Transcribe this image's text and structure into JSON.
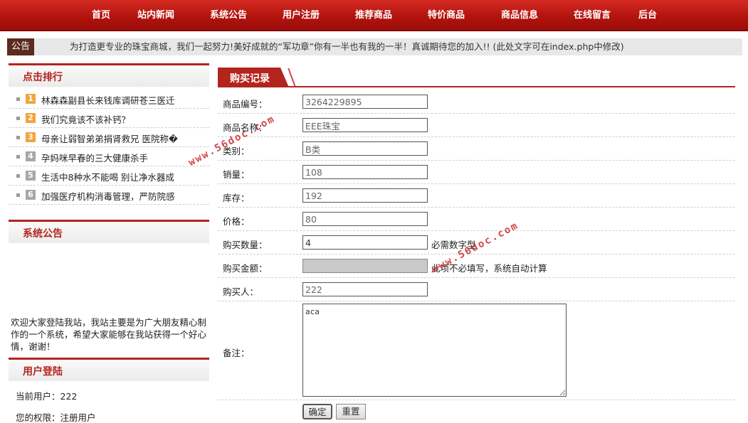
{
  "nav": {
    "items": [
      "首页",
      "站内新闻",
      "系统公告",
      "用户注册",
      "推荐商品",
      "特价商品",
      "商品信息",
      "在线留言",
      "后台"
    ]
  },
  "notice": {
    "tag": "公告",
    "text": "为打造更专业的珠宝商城，我们一起努力!美好成就的“军功章”你有一半也有我的一半！真诚期待您的加入!! (此处文字可在index.php中修改)"
  },
  "sidebar": {
    "rank_title": "点击排行",
    "rank_items": [
      {
        "num": "1",
        "title": "林森森副县长来钱库调研苍三医迁"
      },
      {
        "num": "2",
        "title": "我们究竟该不该补钙？"
      },
      {
        "num": "3",
        "title": "母亲让弱智弟弟捐肾救兄 医院称�"
      },
      {
        "num": "4",
        "title": "孕妈咪早春的三大健康杀手"
      },
      {
        "num": "5",
        "title": "生活中8种水不能喝 别让净水器成"
      },
      {
        "num": "6",
        "title": "加强医疗机构消毒管理，严防院感"
      }
    ],
    "rank_colors": [
      "#f0a53c",
      "#f0a53c",
      "#f0a53c",
      "#a7a7a7",
      "#a7a7a7",
      "#a7a7a7"
    ],
    "announce_title": "系统公告",
    "welcome_text": "欢迎大家登陆我站，我站主要是为广大朋友精心制作的一个系统，希望大家能够在我站获得一个好心情，谢谢！",
    "login_title": "用户登陆",
    "current_user": "当前用户：222",
    "permission": "您的权限：注册用户"
  },
  "main": {
    "title": "购买记录",
    "fields": {
      "code": {
        "label": "商品编号：",
        "value": "3264229895"
      },
      "name": {
        "label": "商品名称：",
        "value": "EEE珠宝"
      },
      "category": {
        "label": "类别：",
        "value": "B类"
      },
      "sales": {
        "label": "销量：",
        "value": "108"
      },
      "stock": {
        "label": "库存：",
        "value": "192"
      },
      "price": {
        "label": "价格：",
        "value": "80"
      },
      "qty": {
        "label": "购买数量：",
        "value": "4",
        "hint": "必需数字型"
      },
      "amount": {
        "label": "购买金额：",
        "value": "",
        "hint": "此项不必填写，系统自动计算"
      },
      "buyer": {
        "label": "购买人：",
        "value": "222"
      },
      "remark": {
        "label": "备注：",
        "value": "aca"
      }
    },
    "confirm_label": "确定",
    "reset_label": "重置"
  },
  "watermark": "www.56doc.com",
  "colors": {
    "brand_red": "#b3241c",
    "nav_red": "#c01a14"
  }
}
